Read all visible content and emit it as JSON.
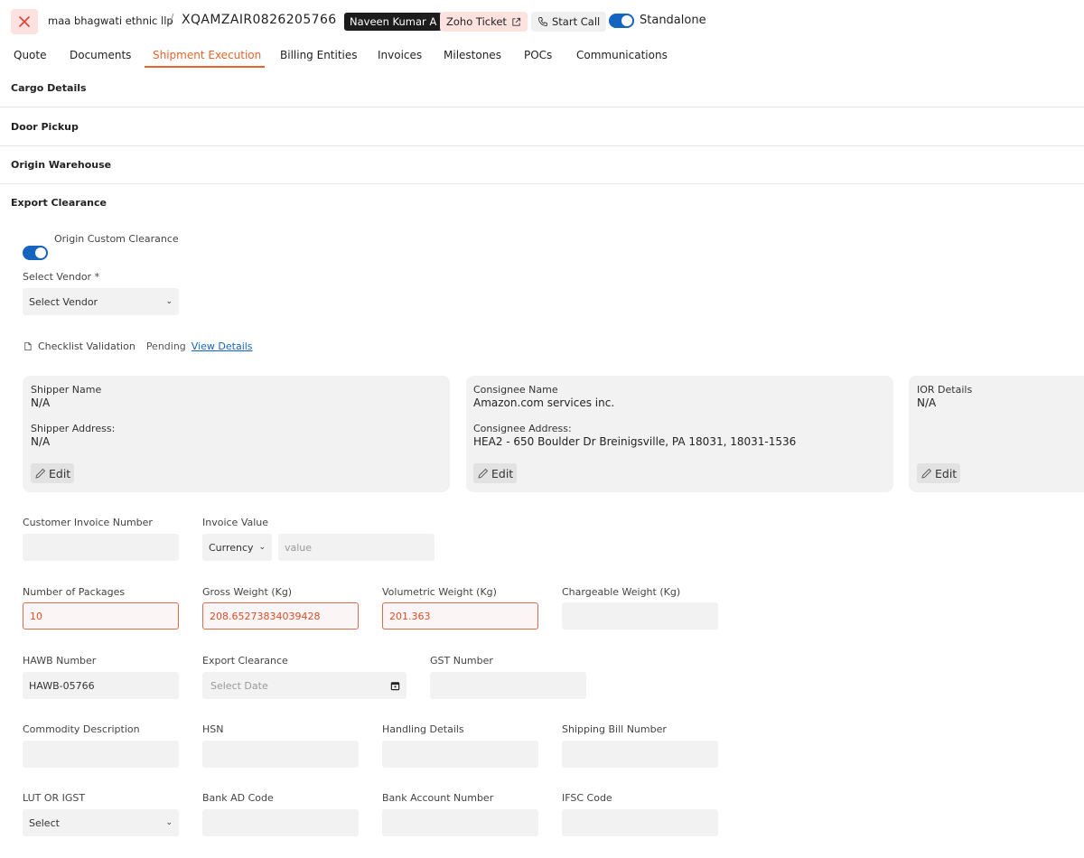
{
  "header": {
    "company": "maa bhagwati ethnic llp",
    "separator": "/",
    "shipment_ref": "XQAMZAIR0826205766",
    "assignee": "Naveen Kumar A",
    "zoho_ticket": "Zoho Ticket",
    "start_call": "Start Call",
    "standalone_label": "Standalone"
  },
  "tabs": [
    {
      "label": "Quote"
    },
    {
      "label": "Documents"
    },
    {
      "label": "Shipment Execution"
    },
    {
      "label": "Billing Entities"
    },
    {
      "label": "Invoices"
    },
    {
      "label": "Milestones"
    },
    {
      "label": "POCs"
    },
    {
      "label": "Communications"
    }
  ],
  "sections": {
    "cargo_details": "Cargo Details",
    "door_pickup": "Door Pickup",
    "origin_warehouse": "Origin Warehouse",
    "export_clearance": "Export Clearance"
  },
  "export": {
    "origin_custom_clearance": "Origin Custom Clearance",
    "select_vendor_label": "Select Vendor *",
    "select_vendor_value": "Select Vendor",
    "checklist_label": "Checklist Validation",
    "checklist_status": "Pending",
    "view_details": "View Details"
  },
  "cards": {
    "shipper": {
      "name_label": "Shipper Name",
      "name_value": "N/A",
      "address_label": "Shipper Address:",
      "address_value": "N/A",
      "edit": "Edit"
    },
    "consignee": {
      "name_label": "Consignee Name",
      "name_value": "Amazon.com services inc.",
      "address_label": "Consignee Address:",
      "address_value": "HEA2 - 650 Boulder Dr Breinigsville, PA 18031, 18031-1536",
      "edit": "Edit"
    },
    "ior": {
      "label": "IOR Details",
      "value": "N/A",
      "edit": "Edit"
    }
  },
  "form": {
    "customer_invoice_number": {
      "label": "Customer Invoice Number",
      "value": ""
    },
    "invoice_value": {
      "label": "Invoice Value",
      "currency": "Currency",
      "placeholder": "value"
    },
    "number_of_packages": {
      "label": "Number of Packages",
      "value": "10"
    },
    "gross_weight": {
      "label": "Gross Weight (Kg)",
      "value": "208.65273834039428"
    },
    "volumetric_weight": {
      "label": "Volumetric Weight (Kg)",
      "value": "201.363"
    },
    "chargeable_weight": {
      "label": "Chargeable Weight (Kg)",
      "value": ""
    },
    "hawb_number": {
      "label": "HAWB Number",
      "value": "HAWB-05766"
    },
    "export_clearance_date": {
      "label": "Export Clearance",
      "placeholder": "Select Date"
    },
    "gst_number": {
      "label": "GST Number",
      "value": ""
    },
    "commodity_description": {
      "label": "Commodity Description",
      "value": ""
    },
    "hsn": {
      "label": "HSN",
      "value": ""
    },
    "handling_details": {
      "label": "Handling Details",
      "value": ""
    },
    "shipping_bill_number": {
      "label": "Shipping Bill Number",
      "value": ""
    },
    "lut_or_igst": {
      "label": "LUT OR IGST",
      "value": "Select"
    },
    "bank_ad_code": {
      "label": "Bank AD Code",
      "value": ""
    },
    "bank_account_number": {
      "label": "Bank Account Number",
      "value": ""
    },
    "ifsc_code": {
      "label": "IFSC Code",
      "value": ""
    }
  },
  "colors": {
    "accent": "#e8642c",
    "toggle": "#1565c0",
    "error_border": "#e06a4d",
    "link": "#1565c0"
  }
}
